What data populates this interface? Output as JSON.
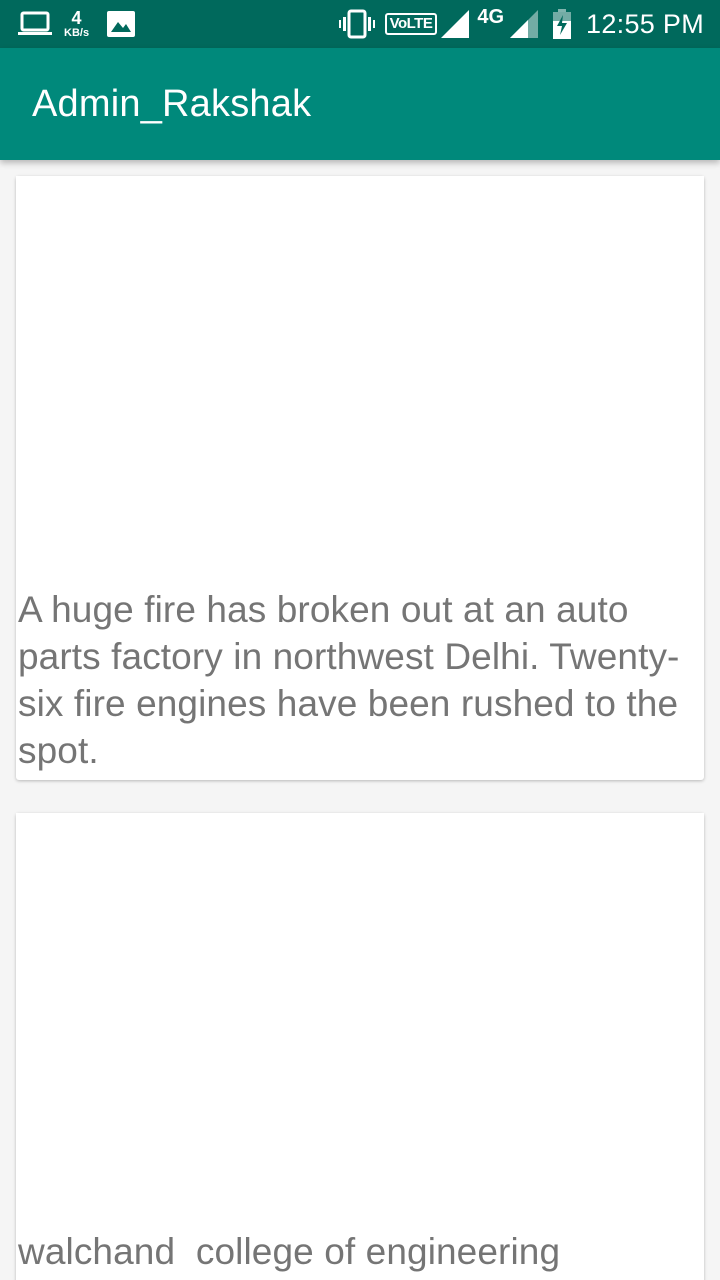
{
  "status_bar": {
    "net_speed_value": "4",
    "net_speed_unit": "KB/s",
    "volte_label": "VoLTE",
    "network_type": "4G",
    "time": "12:55 PM",
    "icon_names": [
      "laptop-icon",
      "image-icon",
      "vibrate-icon",
      "volte-icon",
      "signal-icon",
      "signal-icon",
      "battery-charging-icon"
    ]
  },
  "app_bar": {
    "title": "Admin_Rakshak",
    "color": "#00897b"
  },
  "feed": {
    "items": [
      {
        "text": "A huge fire has broken out at an auto parts factory in northwest Delhi. Twenty-six fire engines have been rushed to the spot."
      },
      {
        "text": "walchand  college of engineering"
      }
    ]
  },
  "colors": {
    "status_bar": "#00695c",
    "app_bar": "#00897b",
    "background": "#f5f5f5",
    "card_text": "#757575"
  }
}
